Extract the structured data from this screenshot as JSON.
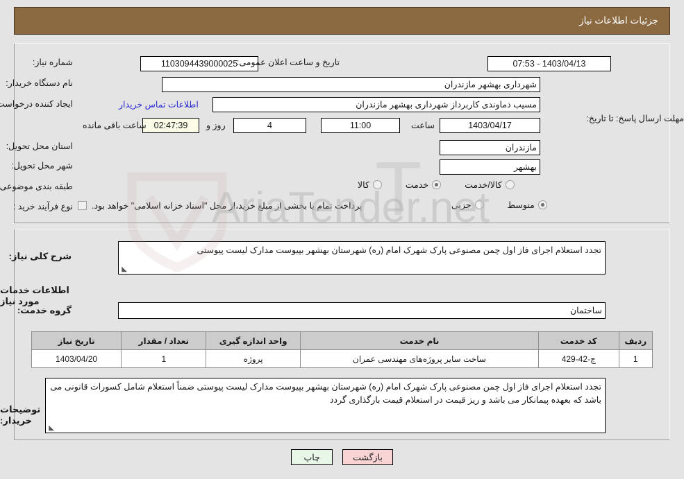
{
  "header": {
    "title": "جزئیات اطلاعات نیاز"
  },
  "form": {
    "need_number_label": "شماره نیاز:",
    "need_number_value": "1103094439000025",
    "announce_datetime_label": "تاریخ و ساعت اعلان عمومی:",
    "announce_datetime_value": "1403/04/13 - 07:53",
    "buyer_org_label": "نام دستگاه خریدار:",
    "buyer_org_value": "شهرداری بهشهر مازندران",
    "creator_label": "ایجاد کننده درخواست:",
    "creator_value": "مسیب دماوندی کاربرداز شهرداری بهشهر مازندران",
    "contact_link": "اطلاعات تماس خریدار",
    "deadline_label": "مهلت ارسال پاسخ: تا تاریخ:",
    "deadline_date": "1403/04/17",
    "time_label": "ساعت",
    "deadline_time": "11:00",
    "days_value": "4",
    "days_label": "روز و",
    "countdown_value": "02:47:39",
    "remaining_label": "ساعت باقی مانده",
    "province_label": "استان محل تحویل:",
    "province_value": "مازندران",
    "city_label": "شهر محل تحویل:",
    "city_value": "بهشهر",
    "category_label": "طبقه بندی موضوعی:",
    "category_options": [
      {
        "label": "کالا",
        "checked": false
      },
      {
        "label": "خدمت",
        "checked": true
      },
      {
        "label": "کالا/خدمت",
        "checked": false
      }
    ],
    "purchase_type_label": "نوع فرآیند خرید :",
    "purchase_type_options": [
      {
        "label": "جزیی",
        "checked": false
      },
      {
        "label": "متوسط",
        "checked": true
      }
    ],
    "treasury_checkbox_label": "پرداخت تمام یا بخشی از مبلغ خرید،از محل \"اسناد خزانه اسلامی\" خواهد بود.",
    "treasury_checked": false
  },
  "description": {
    "general_label": "شرح کلی نیاز:",
    "general_value": "تجدد استعلام اجرای فاز اول چمن مصنوعی پارک شهرک امام (ره) شهرستان بهشهر بپیوست مدارک لیست پیوستی",
    "services_info_heading": "اطلاعات خدمات مورد نیاز",
    "service_group_label": "گروه خدمت:",
    "service_group_value": "ساختمان"
  },
  "table": {
    "headers": [
      "ردیف",
      "کد خدمت",
      "نام خدمت",
      "واحد اندازه گیری",
      "تعداد / مقدار",
      "تاریخ نیاز"
    ],
    "rows": [
      {
        "row": "1",
        "code": "ج-42-429",
        "name": "ساخت سایر پروژه‌های مهندسی عمران",
        "unit": "پروژه",
        "qty": "1",
        "date": "1403/04/20"
      }
    ]
  },
  "buyer_notes": {
    "label": "توضیحات خریدار:",
    "value": "تجدد استعلام اجرای فاز اول چمن مصنوعی پارک شهرک امام (ره) شهرستان بهشهر بپیوست مدارک لیست پیوستی ضمناً استعلام شامل کسورات قانونی می باشد که بعهده پیمانکار می باشد و ریز قیمت در استعلام قیمت بارگذاری گردد"
  },
  "buttons": {
    "print": "چاپ",
    "back": "بازگشت"
  },
  "watermark": {
    "text": "AriaTender.net"
  },
  "colors": {
    "header_bg": "#8b6a42",
    "page_bg": "#e4e4e4",
    "link": "#2a2ad0",
    "table_header_bg": "#cccccc",
    "print_btn_bg": "#e8f6e8",
    "back_btn_bg": "#f8d4d4"
  }
}
